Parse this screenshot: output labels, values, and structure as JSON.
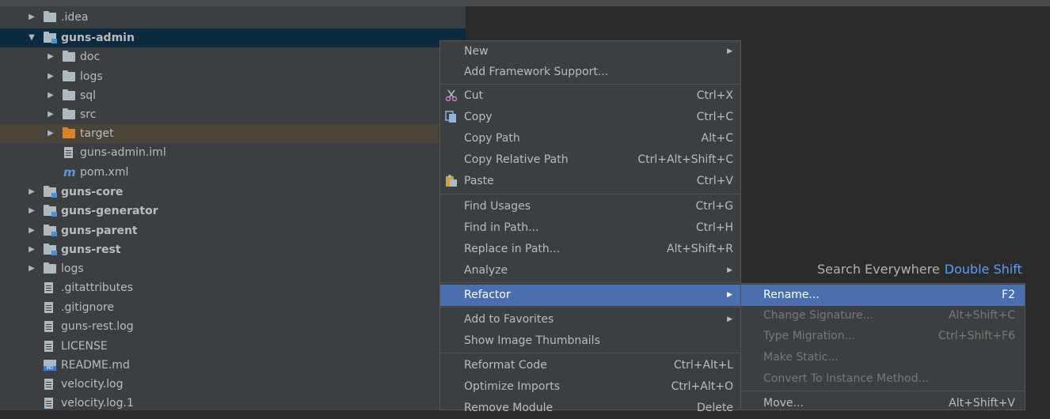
{
  "tree": {
    "items": [
      {
        "label": ".idea",
        "arrow": "▶",
        "icon": "folder-icon"
      },
      {
        "label": "guns-admin",
        "arrow": "▼",
        "icon": "module-icon",
        "bold": true
      },
      {
        "label": "doc",
        "arrow": "▶",
        "icon": "folder-icon"
      },
      {
        "label": "logs",
        "arrow": "▶",
        "icon": "folder-icon"
      },
      {
        "label": "sql",
        "arrow": "▶",
        "icon": "folder-icon"
      },
      {
        "label": "src",
        "arrow": "▶",
        "icon": "folder-icon"
      },
      {
        "label": "target",
        "arrow": "▶",
        "icon": "orange-folder-icon"
      },
      {
        "label": "guns-admin.iml",
        "arrow": "",
        "icon": "iml-file-icon"
      },
      {
        "label": "pom.xml",
        "arrow": "",
        "icon": "maven-icon",
        "icon_glyph": "m"
      },
      {
        "label": "guns-core",
        "arrow": "▶",
        "icon": "module-icon",
        "bold": true
      },
      {
        "label": "guns-generator",
        "arrow": "▶",
        "icon": "module-icon",
        "bold": true
      },
      {
        "label": "guns-parent",
        "arrow": "▶",
        "icon": "module-icon",
        "bold": true
      },
      {
        "label": "guns-rest",
        "arrow": "▶",
        "icon": "module-icon",
        "bold": true
      },
      {
        "label": "logs",
        "arrow": "▶",
        "icon": "folder-icon"
      },
      {
        "label": ".gitattributes",
        "arrow": "",
        "icon": "text-file-icon"
      },
      {
        "label": ".gitignore",
        "arrow": "",
        "icon": "text-file-icon"
      },
      {
        "label": "guns-rest.log",
        "arrow": "",
        "icon": "text-file-icon"
      },
      {
        "label": "LICENSE",
        "arrow": "",
        "icon": "text-file-icon"
      },
      {
        "label": "README.md",
        "arrow": "",
        "icon": "markdown-file-icon"
      },
      {
        "label": "velocity.log",
        "arrow": "",
        "icon": "text-file-icon"
      },
      {
        "label": "velocity.log.1",
        "arrow": "",
        "icon": "text-file-icon"
      }
    ]
  },
  "editor_hint": {
    "text": "Search Everywhere",
    "shortcut": "Double Shift"
  },
  "context_menu": {
    "items": [
      {
        "label": "New",
        "shortcut": "",
        "submenu": true
      },
      {
        "label": "Add Framework Support...",
        "shortcut": ""
      },
      {
        "label": "Cut",
        "shortcut": "Ctrl+X",
        "icon": "scissors-icon"
      },
      {
        "label": "Copy",
        "shortcut": "Ctrl+C",
        "icon": "copy-icon"
      },
      {
        "label": "Copy Path",
        "shortcut": "Alt+C"
      },
      {
        "label": "Copy Relative Path",
        "shortcut": "Ctrl+Alt+Shift+C"
      },
      {
        "label": "Paste",
        "shortcut": "Ctrl+V",
        "icon": "paste-icon"
      },
      {
        "label": "Find Usages",
        "shortcut": "Ctrl+G"
      },
      {
        "label": "Find in Path...",
        "shortcut": "Ctrl+H"
      },
      {
        "label": "Replace in Path...",
        "shortcut": "Alt+Shift+R"
      },
      {
        "label": "Analyze",
        "shortcut": "",
        "submenu": true
      },
      {
        "label": "Refactor",
        "shortcut": "",
        "submenu": true,
        "active": true
      },
      {
        "label": "Add to Favorites",
        "shortcut": "",
        "submenu": true
      },
      {
        "label": "Show Image Thumbnails",
        "shortcut": ""
      },
      {
        "label": "Reformat Code",
        "shortcut": "Ctrl+Alt+L"
      },
      {
        "label": "Optimize Imports",
        "shortcut": "Ctrl+Alt+O"
      },
      {
        "label": "Remove Module",
        "shortcut": "Delete"
      }
    ]
  },
  "refactor_submenu": {
    "items": [
      {
        "label": "Rename...",
        "shortcut": "F2",
        "active": true
      },
      {
        "label": "Change Signature...",
        "shortcut": "Alt+Shift+C",
        "disabled": true
      },
      {
        "label": "Type Migration...",
        "shortcut": "Ctrl+Shift+F6",
        "disabled": true
      },
      {
        "label": "Make Static...",
        "shortcut": "",
        "disabled": true
      },
      {
        "label": "Convert To Instance Method...",
        "shortcut": "",
        "disabled": true
      },
      {
        "label": "Move...",
        "shortcut": "Alt+Shift+V"
      }
    ]
  },
  "colors": {
    "tree_bg": "#3c3f41",
    "selection_bg": "#0d293e",
    "menu_active": "#4b6eaf",
    "hint_key": "#589df6"
  }
}
